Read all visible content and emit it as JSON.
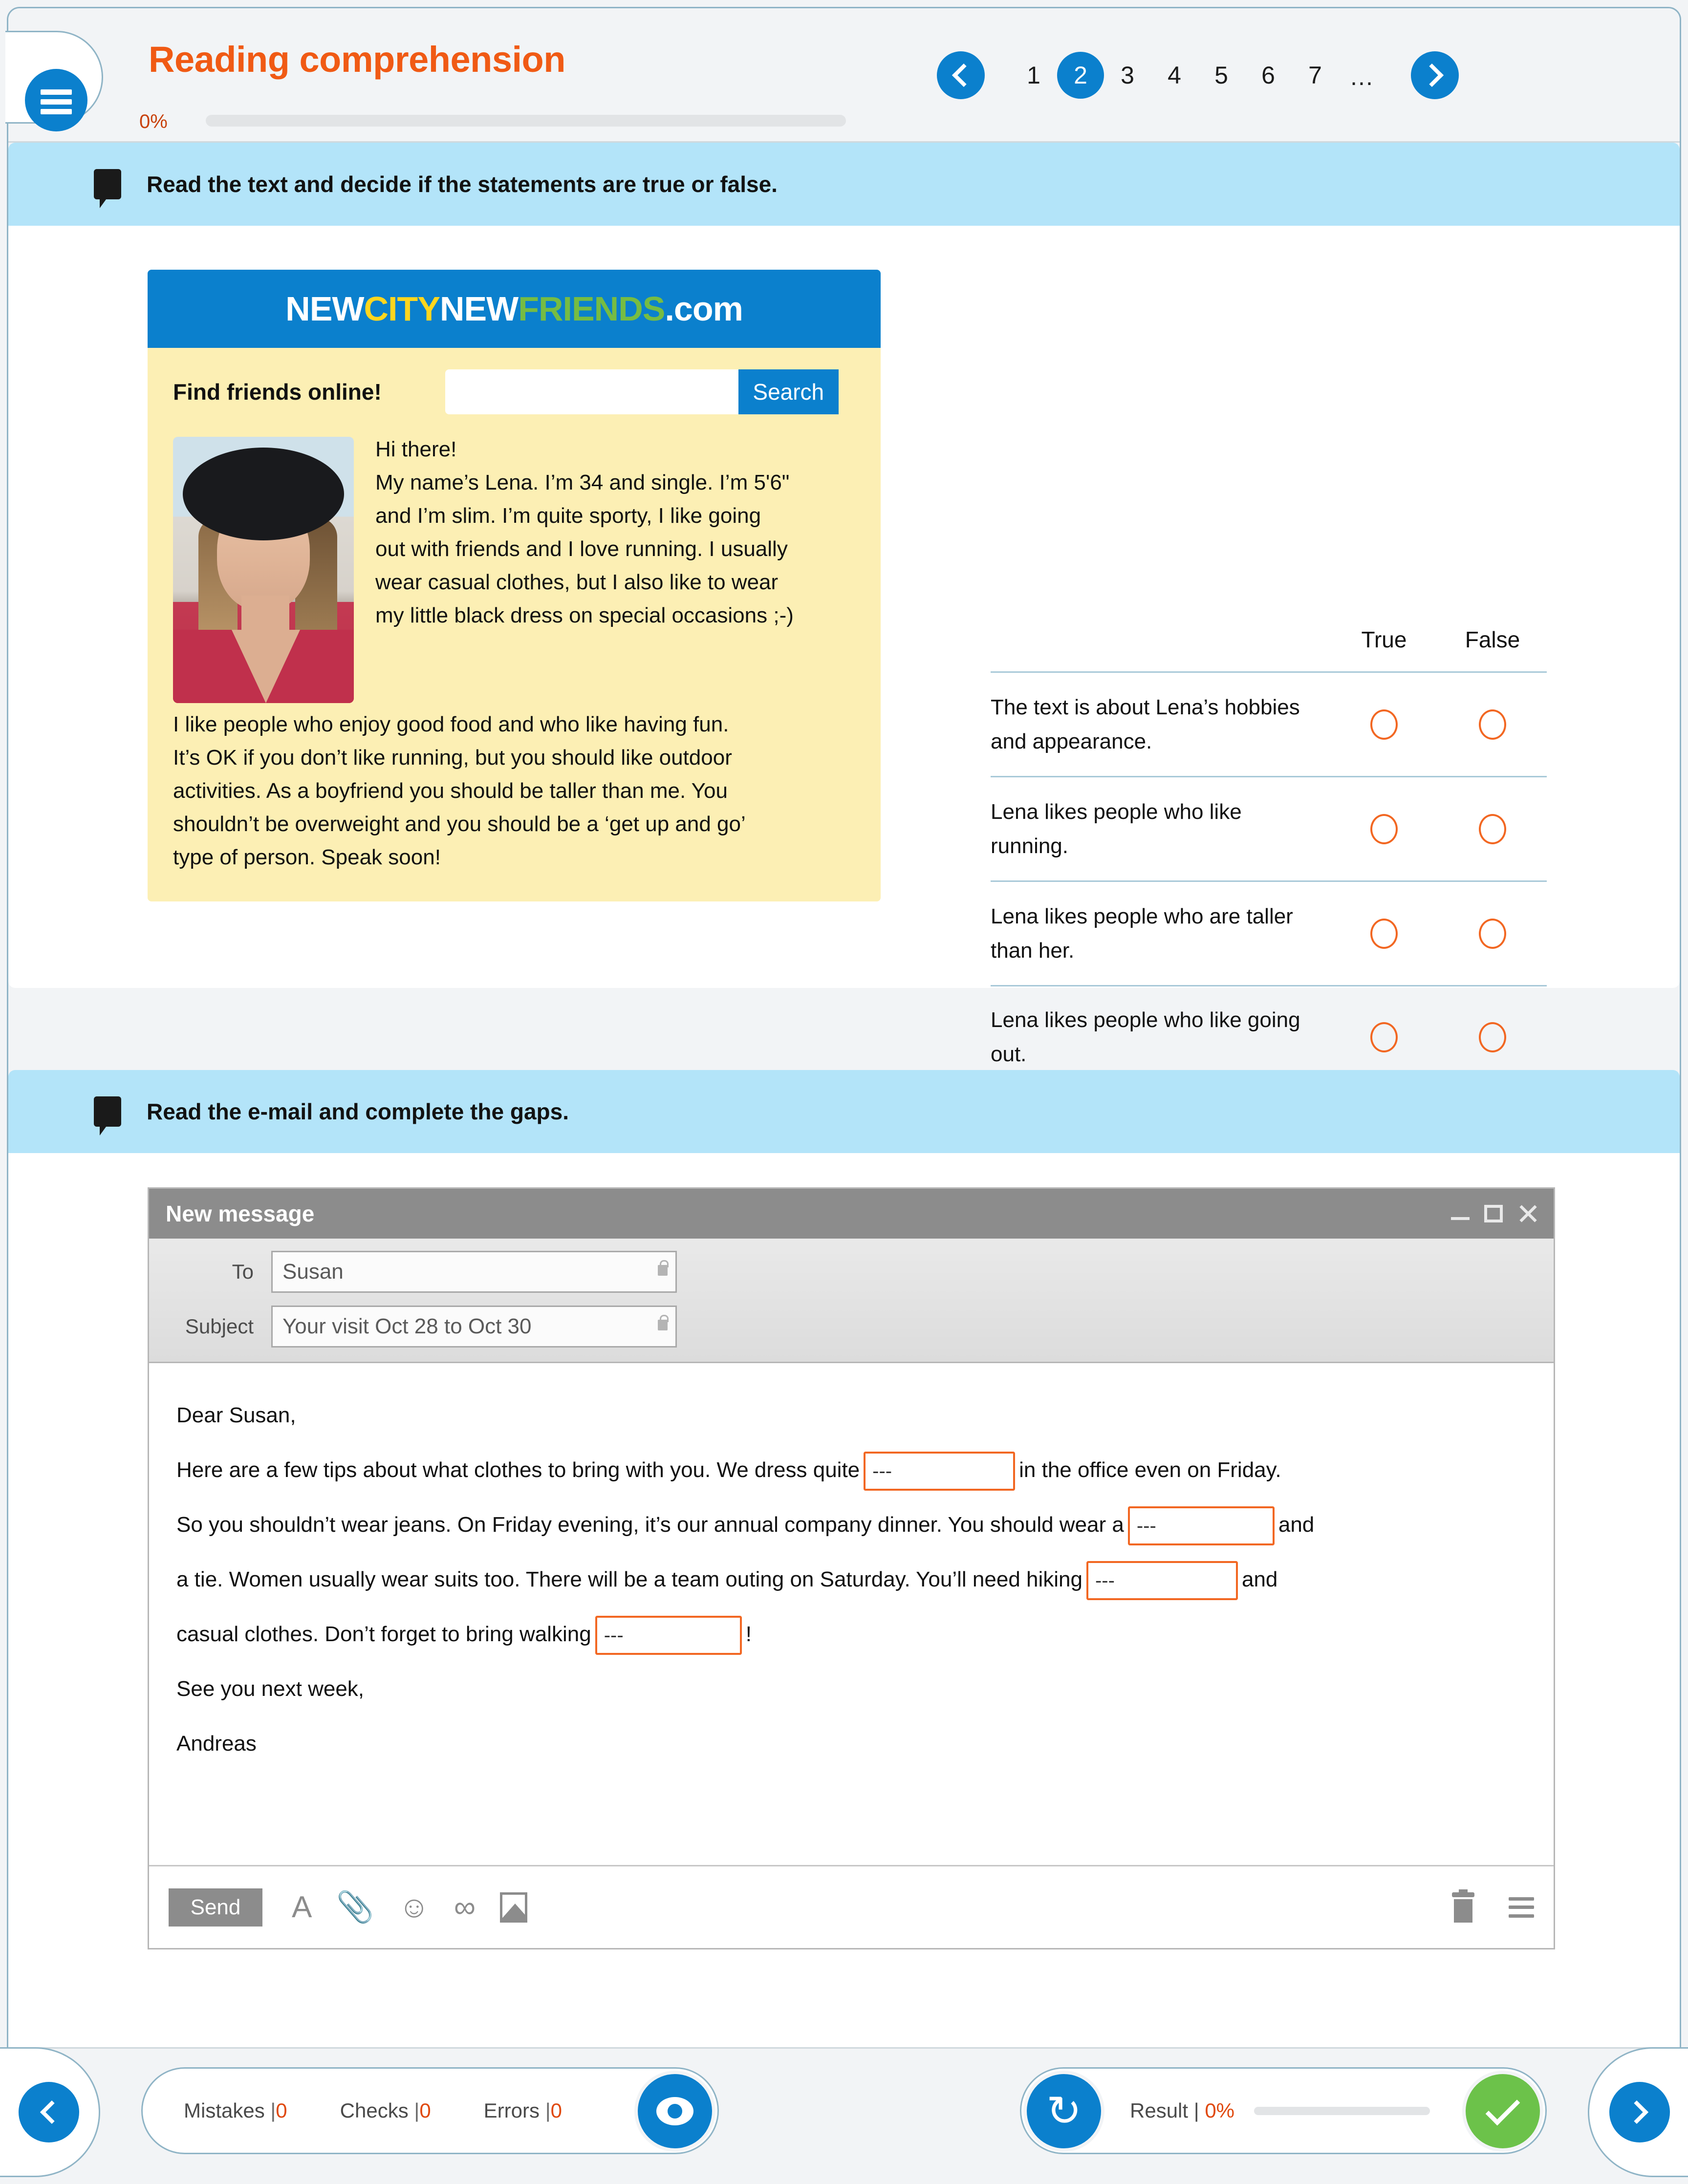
{
  "header": {
    "title": "Reading comprehension",
    "progress_percent": "0%",
    "menu_icon": "hamburger-icon"
  },
  "pagination": {
    "prev_icon": "chevron-left-icon",
    "next_icon": "chevron-right-icon",
    "pages": [
      "1",
      "2",
      "3",
      "4",
      "5",
      "6",
      "7",
      "..."
    ],
    "current": "2"
  },
  "exercise1": {
    "instruction": "Read the text and decide if the statements are true or false.",
    "instruction_icon": "speech-bubble-icon",
    "site": {
      "logo_part1": "NEW",
      "logo_part2": "CITY",
      "logo_part3": "NEW",
      "logo_part4": "FRIENDS",
      "logo_part5": ".com",
      "find_label": "Find friends online!",
      "search_value": "",
      "search_placeholder": "",
      "search_button": "Search",
      "avatar_alt": "profile-photo"
    },
    "profile_text": {
      "greeting": "Hi there!",
      "line1": "My name’s Lena. I’m 34 and single. I’m 5'6\"",
      "line2": "and I’m slim. I’m quite sporty, I like going",
      "line3": "out with friends and I love running. I usually",
      "line4": "wear casual clothes, but I also like to wear",
      "line5": "my little black dress on special occasions ;-)",
      "line6": "I like people who enjoy good food and who like having fun.",
      "line7": "It’s OK if you don’t like running, but you should like outdoor",
      "line8": "activities. As a boyfriend you should be taller than me. You",
      "line9": "shouldn’t be overweight and you should be a ‘get up and go’",
      "line10": "type of person. Speak soon!"
    },
    "table": {
      "col_true": "True",
      "col_false": "False",
      "rows": [
        {
          "statement": "The text is about Lena’s hobbies and appearance.",
          "true_selected": false,
          "false_selected": false
        },
        {
          "statement": "Lena likes people who like running.",
          "true_selected": false,
          "false_selected": false
        },
        {
          "statement": "Lena likes people who are taller than her.",
          "true_selected": false,
          "false_selected": false
        },
        {
          "statement": "Lena likes people who like going out.",
          "true_selected": false,
          "false_selected": false
        }
      ]
    }
  },
  "exercise2": {
    "instruction": "Read the e-mail and complete the gaps.",
    "instruction_icon": "speech-bubble-icon",
    "mail": {
      "window_title": "New message",
      "minimize_icon": "minimize-icon",
      "maximize_icon": "maximize-icon",
      "close_icon": "close-icon",
      "to_label": "To",
      "to_value": "Susan",
      "subject_label": "Subject",
      "subject_value": "Your visit Oct 28 to Oct 30",
      "lock_icon": "lock-icon",
      "body": {
        "salutation": "Dear Susan,",
        "p1_before": "Here are a few tips about what clothes to bring with you. We dress quite",
        "gap1": "---",
        "p1_after": "in the office even on Friday.",
        "p2_before": "So you shouldn’t wear jeans. On Friday evening, it’s our annual company dinner. You should wear a",
        "gap2": "---",
        "p2_after": "and",
        "p3_before": "a tie. Women usually wear suits too. There will be a team outing on Saturday. You’ll need hiking",
        "gap3": "---",
        "p3_after": "and",
        "p4_before": "casual clothes. Don’t forget to bring walking",
        "gap4": "---",
        "p4_after": "!",
        "closing": "See you next week,",
        "signature": "Andreas"
      },
      "toolbar": {
        "send_label": "Send",
        "font_icon": "font-icon",
        "attach_icon": "paperclip-icon",
        "emoji_icon": "smiley-icon",
        "link_icon": "link-icon",
        "image_icon": "image-icon",
        "trash_icon": "trash-icon",
        "menu_icon": "hamburger-menu-icon"
      }
    }
  },
  "footer": {
    "prev_icon": "chevron-left-icon",
    "next_icon": "chevron-right-icon",
    "mistakes_label": "Mistakes",
    "mistakes_value": "0",
    "checks_label": "Checks",
    "checks_value": "0",
    "errors_label": "Errors",
    "errors_value": "0",
    "separator": "|",
    "eye_icon": "eye-icon",
    "refresh_icon": "refresh-icon",
    "result_label": "Result",
    "result_value": "0%",
    "check_icon": "check-icon"
  },
  "colors": {
    "accent_blue": "#0b80cd",
    "accent_orange": "#f05a14",
    "instruction_blue": "#b3e4f9",
    "card_yellow": "#fcefb4",
    "green": "#6cc24a",
    "logo_yellow": "#ffd61e",
    "logo_green": "#76bc43"
  }
}
